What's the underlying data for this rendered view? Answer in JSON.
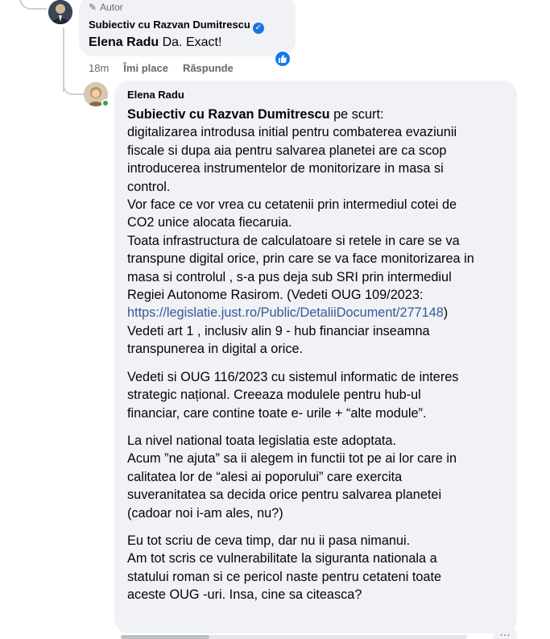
{
  "comment1": {
    "author_tag": "Autor",
    "author": "Subiectiv cu Razvan Dumitrescu",
    "mention": "Elena Radu",
    "text": "Da. Exact!",
    "time": "18m",
    "like_label": "Îmi place",
    "reply_label": "Răspunde"
  },
  "comment2": {
    "author": "Elena Radu",
    "mention": "Subiectiv cu Razvan Dumitrescu",
    "first_line_rest": " pe scurt:",
    "para1": [
      "digitalizarea introdusa initial pentru combaterea evaziunii",
      "fiscale si dupa aia pentru salvarea planetei are ca scop",
      "introducerea instrumentelor de monitorizare in masa si",
      "control.",
      "Vor face ce vor vrea cu cetatenii prin intermediul cotei de",
      "CO2 unice alocata fiecaruia.",
      "Toata infrastructura de calculatoare si retele in care se va",
      "transpune digital orice, prin care se va face monitorizarea in",
      "masa si controlul , s-a pus deja sub SRI prin intermediul",
      "Regiei Autonome Rasirom. (Vedeti OUG 109/2023:"
    ],
    "link_text": "https://legislatie.just.ro/Public/DetaliiDocument/277148",
    "link_suffix": ")",
    "para1_end": [
      "Vedeti art 1 , inclusiv alin 9 - hub financiar inseamna",
      "transpunerea in digital a orice."
    ],
    "para2": [
      "Vedeti si OUG 116/2023 cu sistemul informatic de interes",
      "strategic național. Creeaza modulele pentru hub-ul",
      "financiar, care contine toate e- urile + “alte module”."
    ],
    "para3": [
      "La nivel national toata legislatia este adoptata.",
      "Acum ”ne ajuta” sa ii alegem in functii tot pe ai lor care in",
      "calitatea lor de “alesi ai poporului” care exercita",
      "suveranitatea sa decida orice pentru salvarea planetei",
      "(cadoar noi i-am ales, nu?)"
    ],
    "para4": [
      "Eu tot scriu de ceva timp, dar nu ii pasa nimanui.",
      "Am tot scris ce vulnerabilitate la siguranta nationala a",
      "statului roman si ce pericol naste pentru cetateni toate",
      "aceste OUG -uri. Insa, cine sa citeasca?"
    ],
    "more_icon": "…"
  },
  "icons": {
    "verified": "✓",
    "author_pen": "✎"
  },
  "colors": {
    "bubble": "#f0f2f5",
    "link": "#385898",
    "like": "#1877f2",
    "verified": "#1b74e4",
    "online": "#31a24c"
  }
}
